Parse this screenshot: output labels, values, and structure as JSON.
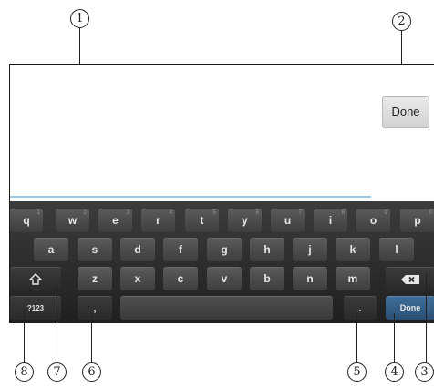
{
  "callouts": [
    "1",
    "2",
    "3",
    "4",
    "5",
    "6",
    "7",
    "8"
  ],
  "done_button": {
    "label": "Done"
  },
  "keyboard": {
    "row1": [
      {
        "key": "q",
        "hint": "1"
      },
      {
        "key": "w",
        "hint": "2"
      },
      {
        "key": "e",
        "hint": "3"
      },
      {
        "key": "r",
        "hint": "4"
      },
      {
        "key": "t",
        "hint": "5"
      },
      {
        "key": "y",
        "hint": "6"
      },
      {
        "key": "u",
        "hint": "7"
      },
      {
        "key": "i",
        "hint": "8"
      },
      {
        "key": "o",
        "hint": "9"
      },
      {
        "key": "p",
        "hint": "0"
      }
    ],
    "row2": [
      "a",
      "s",
      "d",
      "f",
      "g",
      "h",
      "j",
      "k",
      "l"
    ],
    "row3": [
      "z",
      "x",
      "c",
      "v",
      "b",
      "n",
      "m"
    ],
    "shift_icon": "shift-up-arrow-icon",
    "backspace_icon": "backspace-icon",
    "symbols_label": "?123",
    "comma_label": ",",
    "period_label": ".",
    "done_label": "Done"
  }
}
